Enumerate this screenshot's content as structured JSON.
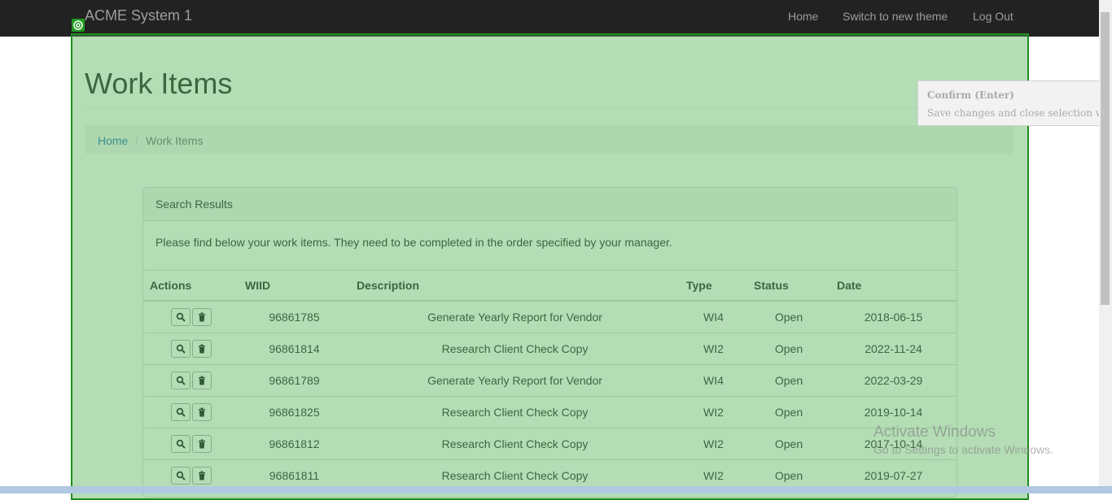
{
  "app": {
    "brand": "ACME System 1"
  },
  "nav": {
    "home": "Home",
    "switch_theme": "Switch to new theme",
    "logout": "Log Out"
  },
  "page": {
    "title": "Work Items"
  },
  "breadcrumb": {
    "home": "Home",
    "separator": "/",
    "current": "Work Items"
  },
  "panel": {
    "heading": "Search Results",
    "body": "Please find below your work items. They need to be completed in the order specified by your manager."
  },
  "table": {
    "headers": [
      "Actions",
      "WIID",
      "Description",
      "Type",
      "Status",
      "Date"
    ],
    "rows": [
      {
        "wiid": "96861785",
        "description": "Generate Yearly Report for Vendor",
        "type": "WI4",
        "status": "Open",
        "date": "2018-06-15"
      },
      {
        "wiid": "96861814",
        "description": "Research Client Check Copy",
        "type": "WI2",
        "status": "Open",
        "date": "2022-11-24"
      },
      {
        "wiid": "96861789",
        "description": "Generate Yearly Report for Vendor",
        "type": "WI4",
        "status": "Open",
        "date": "2022-03-29"
      },
      {
        "wiid": "96861825",
        "description": "Research Client Check Copy",
        "type": "WI2",
        "status": "Open",
        "date": "2019-10-14"
      },
      {
        "wiid": "96861812",
        "description": "Research Client Check Copy",
        "type": "WI2",
        "status": "Open",
        "date": "2017-10-14"
      },
      {
        "wiid": "96861811",
        "description": "Research Client Check Copy",
        "type": "WI2",
        "status": "Open",
        "date": "2019-07-27"
      }
    ]
  },
  "tooltip": {
    "title": "Confirm (Enter)",
    "text": "Save changes and close selection wizard."
  },
  "watermark": {
    "line1": "Activate Windows",
    "line2": "Go to Settings to activate Windows."
  },
  "colors": {
    "navbar": "#222222",
    "overlay": "#4caf50",
    "link": "#337ab7"
  },
  "icons": {
    "view": "search-icon",
    "delete": "trash-icon"
  }
}
